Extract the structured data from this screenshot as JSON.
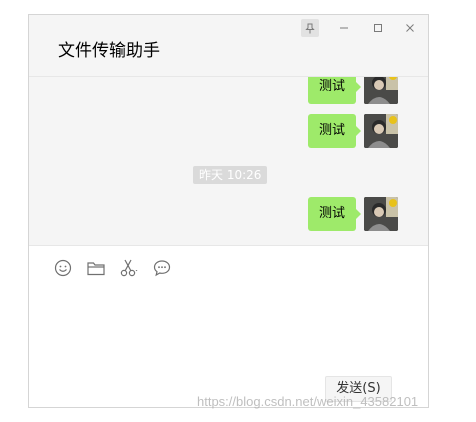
{
  "window": {
    "title": "文件传输助手",
    "controls": {
      "pin_icon": "pin-icon",
      "minimize_icon": "minimize-icon",
      "maximize_icon": "maximize-icon",
      "close_icon": "close-icon"
    }
  },
  "chat": {
    "messages": [
      {
        "text": "测试",
        "sender": "self"
      },
      {
        "text": "测试",
        "sender": "self"
      },
      {
        "text": "测试",
        "sender": "self"
      }
    ],
    "timestamp": "昨天 10:26",
    "bubble_color": "#9eea6a",
    "background_color": "#f5f5f5"
  },
  "toolbar": {
    "icons": [
      "emoji-icon",
      "folder-icon",
      "scissors-icon",
      "chat-bubble-icon"
    ]
  },
  "composer": {
    "send_label": "发送(S)"
  },
  "watermark": "https://blog.csdn.net/weixin_43582101"
}
